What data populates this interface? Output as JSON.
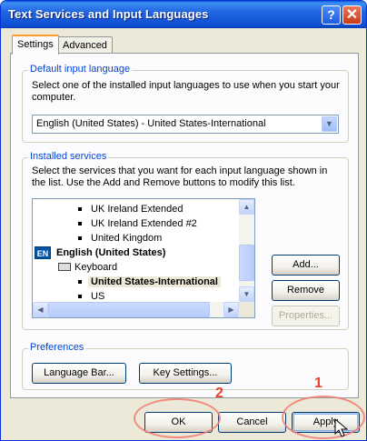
{
  "window": {
    "title": "Text Services and Input Languages",
    "help_glyph": "?",
    "close_glyph": "✕"
  },
  "tabs": [
    {
      "label": "Settings",
      "active": true
    },
    {
      "label": "Advanced",
      "active": false
    }
  ],
  "default_language": {
    "group_label": "Default input language",
    "description": "Select one of the installed input languages to use when you start your computer.",
    "selected_value": "English (United States) - United States-International"
  },
  "installed_services": {
    "group_label": "Installed services",
    "description": "Select the services that you want for each input language shown in the list. Use the Add and Remove buttons to modify this list.",
    "items": [
      {
        "label": "UK Ireland Extended",
        "kind": "layout"
      },
      {
        "label": "UK Ireland Extended #2",
        "kind": "layout"
      },
      {
        "label": "United Kingdom",
        "kind": "layout"
      },
      {
        "label": "English (United States)",
        "kind": "language",
        "badge": "EN"
      },
      {
        "label": "Keyboard",
        "kind": "category"
      },
      {
        "label": "United States-International",
        "kind": "layout",
        "selected": true
      },
      {
        "label": "US",
        "kind": "layout"
      }
    ],
    "buttons": {
      "add": "Add...",
      "remove": "Remove",
      "properties": "Properties..."
    }
  },
  "preferences": {
    "group_label": "Preferences",
    "language_bar_button": "Language Bar...",
    "key_settings_button": "Key Settings..."
  },
  "footer": {
    "ok": "OK",
    "cancel": "Cancel",
    "apply": "Apply"
  },
  "annotations": {
    "marker_1": "1",
    "marker_2": "2",
    "color": "#e8412e"
  }
}
